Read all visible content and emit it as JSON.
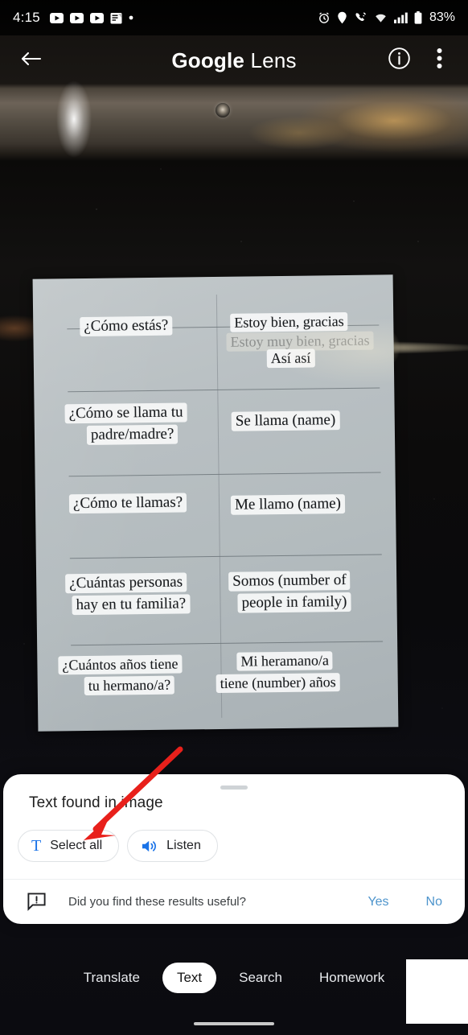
{
  "status_bar": {
    "time": "4:15",
    "left_icons": [
      "youtube-play-icon",
      "youtube-play-icon",
      "youtube-play-icon",
      "calendar-note-icon",
      "dot-icon"
    ],
    "right_icons": [
      "alarm-icon",
      "location-pin-icon",
      "phone-call-icon",
      "wifi-icon",
      "signal-bars-icon",
      "battery-icon"
    ],
    "battery_percent": "83%"
  },
  "app_bar": {
    "back_label": "Back",
    "title_brand": "Google",
    "title_rest": " Lens",
    "info_label": "Info",
    "more_label": "More options"
  },
  "camera_scene": {
    "description": "Photo of a paper flashcard sheet of Spanish phrases on a dark glossy surface",
    "paper": {
      "rows": [
        {
          "question": "¿Cómo estás?",
          "answers": [
            "Estoy bien, gracias",
            "Estoy muy bien, gracias",
            "Así así"
          ]
        },
        {
          "question": "¿Cómo se llama tu padre/madre?",
          "answers": [
            "Se llama (name)"
          ]
        },
        {
          "question": "¿Cómo te llamas?",
          "answers": [
            "Me llamo (name)"
          ]
        },
        {
          "question": "¿Cuántas personas hay en tu familia?",
          "answers": [
            "Somos (number of people in family)"
          ]
        },
        {
          "question": "¿Cuántos años tiene tu hermano/a?",
          "answers": [
            "Mi heramano/a tiene (number) años"
          ]
        }
      ],
      "ocr_chunks": [
        "¿Cómo estás?",
        "Estoy bien, gracias",
        "Estoy muy bien, gracias",
        "Así así",
        "¿Cómo se llama tu",
        "padre/madre?",
        "Se llama (name)",
        "¿Cómo te llamas?",
        "Me llamo (name)",
        "¿Cuántas personas",
        "hay en tu familia?",
        "Somos (number of",
        "people in family)",
        "¿Cuántos años tiene",
        "tu hermano/a?",
        "Mi heramano/a",
        "tiene (number) años"
      ]
    }
  },
  "sheet": {
    "title": "Text found in image",
    "chips": [
      {
        "label": "Select all",
        "icon": "text-select-icon"
      },
      {
        "label": "Listen",
        "icon": "speaker-icon"
      }
    ],
    "feedback": {
      "icon": "feedback-bubble-icon",
      "question": "Did you find these results useful?",
      "yes_label": "Yes",
      "no_label": "No"
    }
  },
  "mode_bar": {
    "modes": [
      {
        "label": "Translate",
        "active": false
      },
      {
        "label": "Text",
        "active": true
      },
      {
        "label": "Search",
        "active": false
      },
      {
        "label": "Homework",
        "active": false
      }
    ]
  },
  "annotation": {
    "type": "arrow",
    "color": "#e8201b",
    "points_at": "Select all"
  },
  "colors": {
    "accent_blue": "#1a73e8",
    "link_blue": "#4d94cc",
    "sheet_bg": "#ffffff",
    "app_bg": "#000000",
    "annotation_red": "#e8201b"
  }
}
